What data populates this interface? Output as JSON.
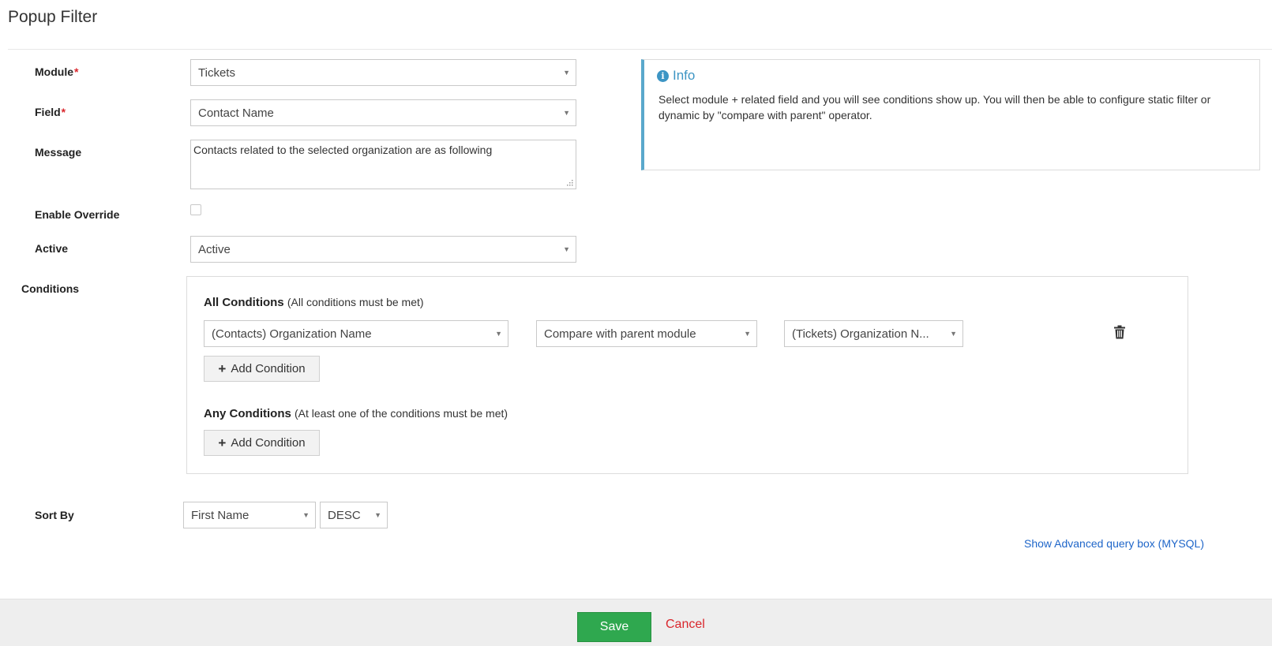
{
  "page_title": "Popup Filter",
  "form": {
    "module": {
      "label": "Module",
      "required_mark": "*",
      "value": "Tickets"
    },
    "field": {
      "label": "Field",
      "required_mark": "*",
      "value": "Contact Name"
    },
    "message": {
      "label": "Message",
      "value": "Contacts related to the selected organization are as following"
    },
    "enable_override": {
      "label": "Enable Override",
      "checked": false
    },
    "active": {
      "label": "Active",
      "value": "Active"
    }
  },
  "info": {
    "title": "Info",
    "icon": "info-circle-icon",
    "text": "Select module + related field and you will see conditions show up. You will then be able to configure static filter or dynamic by \"compare with parent\" operator."
  },
  "conditions": {
    "label": "Conditions",
    "all": {
      "title": "All Conditions",
      "subtitle": "(All conditions must be met)",
      "rows": [
        {
          "field": "(Contacts) Organization Name",
          "operator": "Compare with parent module",
          "value": "(Tickets) Organization N..."
        }
      ],
      "add_label": "Add Condition"
    },
    "any": {
      "title": "Any Conditions",
      "subtitle": "(At least one of the conditions must be met)",
      "add_label": "Add Condition"
    }
  },
  "sort": {
    "label": "Sort By",
    "field": "First Name",
    "order": "DESC"
  },
  "advanced_link": "Show Advanced query box (MYSQL)",
  "footer": {
    "save_label": "Save",
    "cancel_label": "Cancel"
  },
  "colors": {
    "save": "#2fa84f",
    "cancel": "#d9262c",
    "link": "#1f66c9",
    "info_accent": "#3d95c4",
    "required": "#d9262c"
  }
}
